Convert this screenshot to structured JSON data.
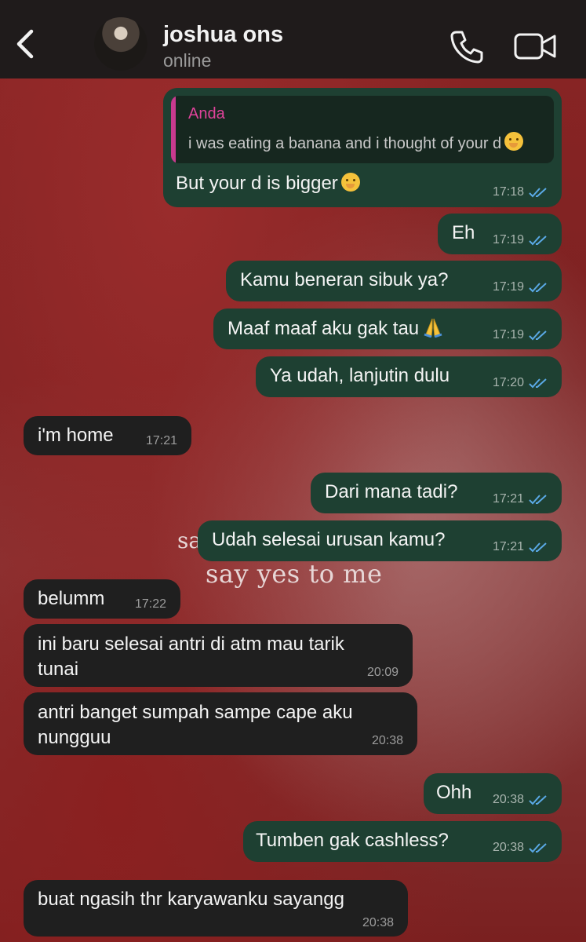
{
  "header": {
    "contact_name": "joshua ons",
    "status": "online"
  },
  "wallpaper": {
    "line1_partial": "sa",
    "line2": "say yes to me"
  },
  "quote": {
    "author": "Anda",
    "text": "i was eating a banana and i thought of your d"
  },
  "messages": [
    {
      "text": "But your d is bigger",
      "time": "17:18",
      "dir": "out"
    },
    {
      "text": "Eh",
      "time": "17:19",
      "dir": "out"
    },
    {
      "text": "Kamu beneran sibuk ya?",
      "time": "17:19",
      "dir": "out"
    },
    {
      "text": "Maaf maaf aku gak tau",
      "time": "17:19",
      "dir": "out"
    },
    {
      "text": "Ya udah, lanjutin dulu",
      "time": "17:20",
      "dir": "out"
    },
    {
      "text": "i'm home",
      "time": "17:21",
      "dir": "in"
    },
    {
      "text": "Dari mana tadi?",
      "time": "17:21",
      "dir": "out"
    },
    {
      "text": "Udah selesai urusan kamu?",
      "time": "17:21",
      "dir": "out"
    },
    {
      "text": "belumm",
      "time": "17:22",
      "dir": "in"
    },
    {
      "text": "ini baru selesai antri di atm mau tarik\ntunai",
      "time": "20:09",
      "dir": "in"
    },
    {
      "text": "antri banget sumpah sampe cape aku\nnungguu",
      "time": "20:38",
      "dir": "in"
    },
    {
      "text": "Ohh",
      "time": "20:38",
      "dir": "out"
    },
    {
      "text": "Tumben gak cashless?",
      "time": "20:38",
      "dir": "out"
    },
    {
      "text": "buat ngasih thr karyawanku sayangg",
      "time": "20:38",
      "dir": "in"
    }
  ],
  "colors": {
    "outgoing_bubble": "#1e4032",
    "incoming_bubble": "#1f1f1f",
    "read_ticks": "#5aa9e6",
    "quote_accent": "#c83a8f"
  },
  "icons": [
    "back-chevron-icon",
    "phone-icon",
    "video-camera-icon",
    "double-check-icon",
    "face-emoji-icon",
    "praying-hands-emoji-icon"
  ]
}
